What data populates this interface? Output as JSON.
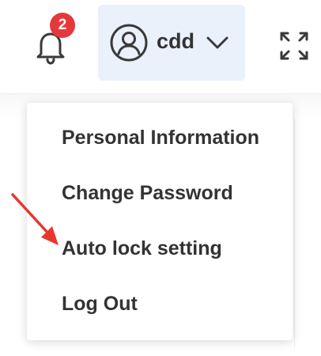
{
  "header": {
    "notifications": {
      "icon": "bell-icon",
      "count": "2",
      "badge_color": "#e4393c"
    },
    "user_menu": {
      "avatar_icon": "user-circle-icon",
      "username": "cdd",
      "chevron_icon": "chevron-down-icon",
      "background": "#eaf1fb"
    },
    "fullscreen": {
      "icon": "fullscreen-icon"
    }
  },
  "dropdown": {
    "items": [
      {
        "label": "Personal Information"
      },
      {
        "label": "Change Password"
      },
      {
        "label": "Auto lock setting"
      },
      {
        "label": "Log Out"
      }
    ]
  },
  "annotation": {
    "type": "arrow-pointer",
    "target": "Auto lock setting",
    "color": "#e8362f"
  }
}
